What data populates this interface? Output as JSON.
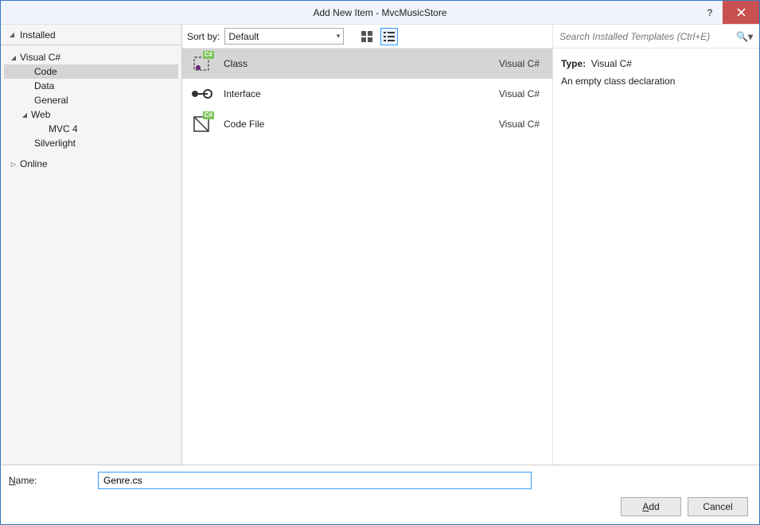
{
  "window": {
    "title": "Add New Item - MvcMusicStore"
  },
  "sidebar": {
    "header": "Installed",
    "items": [
      {
        "label": "Visual C#"
      },
      {
        "label": "Code"
      },
      {
        "label": "Data"
      },
      {
        "label": "General"
      },
      {
        "label": "Web"
      },
      {
        "label": "MVC 4"
      },
      {
        "label": "Silverlight"
      },
      {
        "label": "Online"
      }
    ]
  },
  "toolbar": {
    "sort_label": "Sort by:",
    "sort_value": "Default"
  },
  "search": {
    "placeholder": "Search Installed Templates (Ctrl+E)"
  },
  "templates": [
    {
      "name": "Class",
      "lang": "Visual C#"
    },
    {
      "name": "Interface",
      "lang": "Visual C#"
    },
    {
      "name": "Code File",
      "lang": "Visual C#"
    }
  ],
  "detail": {
    "type_prefix": "Type:",
    "type_value": "Visual C#",
    "description": "An empty class declaration"
  },
  "footer": {
    "name_label_rest": "ame:",
    "name_value": "Genre.cs",
    "add_rest": "dd",
    "cancel": "Cancel"
  }
}
